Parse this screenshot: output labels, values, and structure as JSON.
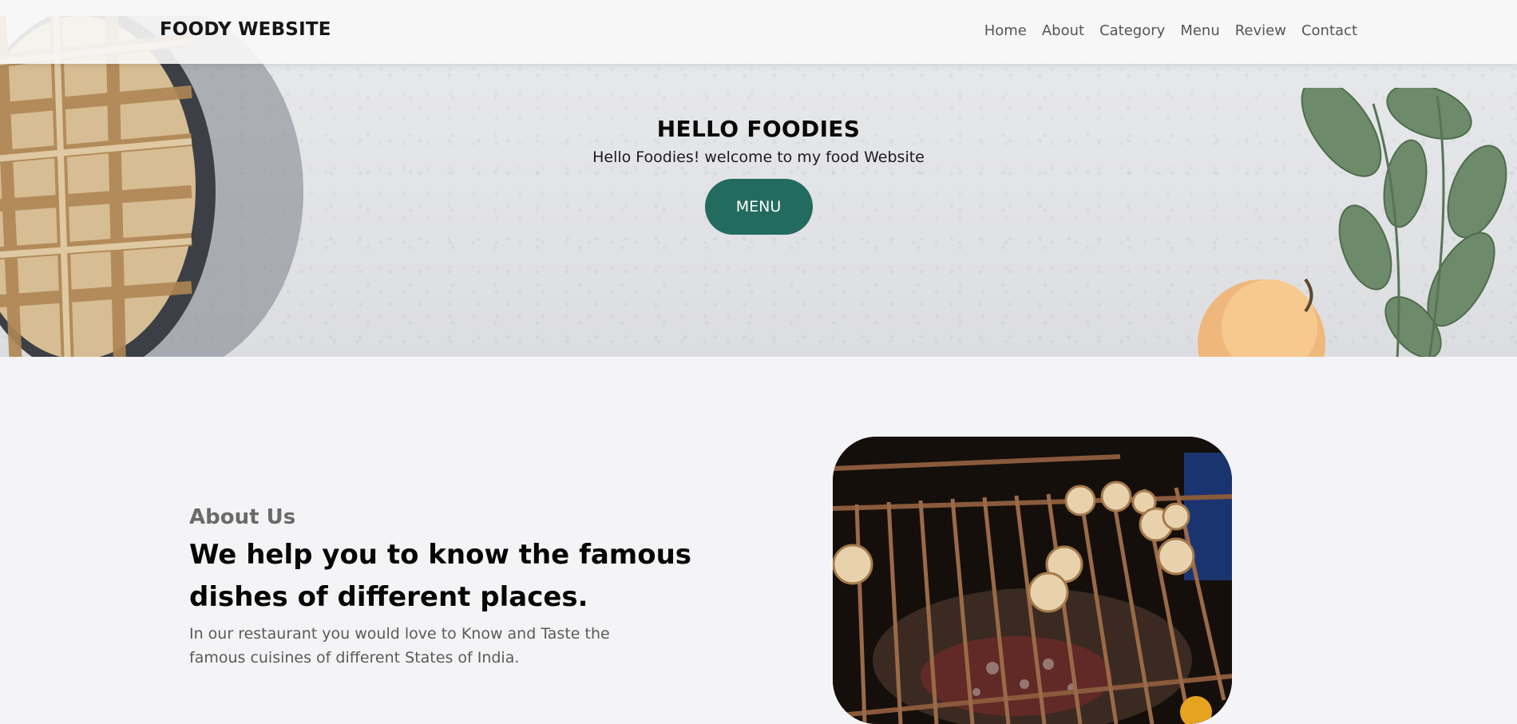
{
  "brand": "FOODY WEBSITE",
  "nav": {
    "links": [
      "Home",
      "About",
      "Category",
      "Menu",
      "Review",
      "Contact"
    ]
  },
  "hero": {
    "title": "HELLO FOODIES",
    "subtitle": "Hello Foodies! welcome to my food Website",
    "button_label": "MENU"
  },
  "about": {
    "kicker": "About Us",
    "heading_line1": "We help you to know the famous",
    "heading_line2": "dishes of different places.",
    "body": "In our restaurant you would love to Know and Taste the famous cuisines of different States of India."
  },
  "colors": {
    "accent": "#236b5f",
    "page_bg": "#f4f4f6",
    "navbar_bg": "#f8f8f8"
  },
  "icons": {
    "hero_left": "pie-image",
    "hero_right": "leaves-and-apple-image",
    "about": "grill-image"
  }
}
